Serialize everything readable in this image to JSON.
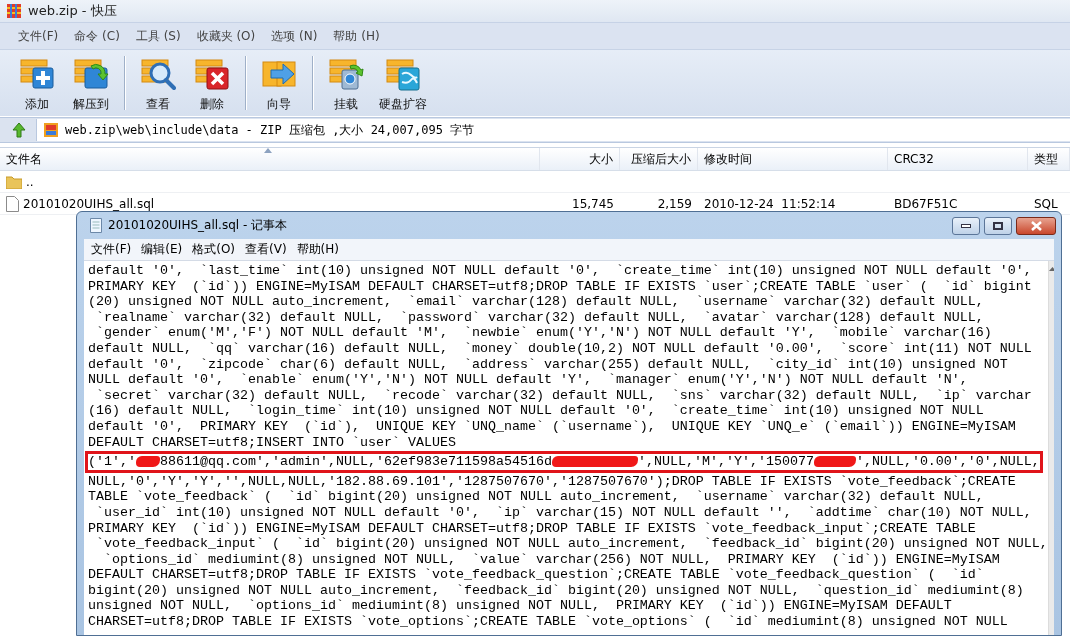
{
  "window": {
    "title": "web.zip - 快压"
  },
  "menu": [
    "文件(F)",
    "命令 (C)",
    "工具 (S)",
    "收藏夹 (O)",
    "选项 (N)",
    "帮助 (H)"
  ],
  "toolbar_groups": [
    [
      {
        "kind": "add",
        "label": "添加"
      },
      {
        "kind": "extract",
        "label": "解压到"
      }
    ],
    [
      {
        "kind": "view",
        "label": "查看"
      },
      {
        "kind": "delete",
        "label": "删除"
      }
    ],
    [
      {
        "kind": "wizard",
        "label": "向导"
      }
    ],
    [
      {
        "kind": "mount",
        "label": "挂载"
      },
      {
        "kind": "disk",
        "label": "硬盘扩容"
      }
    ]
  ],
  "address_bar": {
    "path": "web.zip\\web\\include\\data - ZIP 压缩包 ,大小 24,007,095 字节"
  },
  "file_list": {
    "columns": [
      "文件名",
      "大小",
      "压缩后大小",
      "修改时间",
      "CRC32",
      "类型"
    ],
    "rows": [
      {
        "kind": "folder",
        "cells": [
          ".."
        ]
      },
      {
        "kind": "file",
        "cells": [
          "20101020UIHS_all.sql",
          "15,745",
          "2,159",
          "2010-12-24  11:52:14",
          "BD67F51C",
          "SQL"
        ]
      }
    ]
  },
  "notepad": {
    "title": "20101020UIHS_all.sql - 记事本",
    "menu": [
      "文件(F)",
      "编辑(E)",
      "格式(O)",
      "查看(V)",
      "帮助(H)"
    ],
    "lines": [
      {
        "kind": "plain",
        "text": "default '0',  `last_time` int(10) unsigned NOT NULL default '0',  `create_time` int(10) unsigned NOT NULL default '0',"
      },
      {
        "kind": "plain",
        "text": "PRIMARY KEY  (`id`)) ENGINE=MyISAM DEFAULT CHARSET=utf8;DROP TABLE IF EXISTS `user`;CREATE TABLE `user` (  `id` bigint"
      },
      {
        "kind": "plain",
        "text": "(20) unsigned NOT NULL auto_increment,  `email` varchar(128) default NULL,  `username` varchar(32) default NULL,"
      },
      {
        "kind": "plain",
        "text": " `realname` varchar(32) default NULL,  `password` varchar(32) default NULL,  `avatar` varchar(128) default NULL,"
      },
      {
        "kind": "plain",
        "text": " `gender` enum('M','F') NOT NULL default 'M',  `newbie` enum('Y','N') NOT NULL default 'Y',  `mobile` varchar(16)"
      },
      {
        "kind": "plain",
        "text": "default NULL,  `qq` varchar(16) default NULL,  `money` double(10,2) NOT NULL default '0.00',  `score` int(11) NOT NULL"
      },
      {
        "kind": "plain",
        "text": "default '0',  `zipcode` char(6) default NULL,  `address` varchar(255) default NULL,  `city_id` int(10) unsigned NOT"
      },
      {
        "kind": "plain",
        "text": "NULL default '0',  `enable` enum('Y','N') NOT NULL default 'Y',  `manager` enum('Y','N') NOT NULL default 'N',"
      },
      {
        "kind": "plain",
        "text": " `secret` varchar(32) default NULL,  `recode` varchar(32) default NULL,  `sns` varchar(32) default NULL,  `ip` varchar"
      },
      {
        "kind": "plain",
        "text": "(16) default NULL,  `login_time` int(10) unsigned NOT NULL default '0',  `create_time` int(10) unsigned NOT NULL"
      },
      {
        "kind": "plain",
        "text": "default '0',  PRIMARY KEY  (`id`),  UNIQUE KEY `UNQ_name` (`username`),  UNIQUE KEY `UNQ_e` (`email`)) ENGINE=MyISAM"
      },
      {
        "kind": "plain",
        "text": "DEFAULT CHARSET=utf8;INSERT INTO `user` VALUES"
      },
      {
        "kind": "highlighted",
        "segments": [
          {
            "kind": "text",
            "text": "('1','"
          },
          {
            "kind": "redaction"
          },
          {
            "kind": "text",
            "text": "88611@qq.com','admin',NULL,'62ef983e711598a54516d"
          },
          {
            "kind": "redaction"
          },
          {
            "kind": "text",
            "text": "',NULL,'M','Y','150077"
          },
          {
            "kind": "redaction"
          },
          {
            "kind": "text",
            "text": "',NULL,'0.00','0',NULL,"
          }
        ]
      },
      {
        "kind": "plain",
        "text": "NULL,'0','Y','Y','',NULL,NULL,'182.88.69.101','1287507670','1287507670');DROP TABLE IF EXISTS `vote_feedback`;CREATE"
      },
      {
        "kind": "plain",
        "text": "TABLE `vote_feedback` (  `id` bigint(20) unsigned NOT NULL auto_increment,  `username` varchar(32) default NULL,"
      },
      {
        "kind": "plain",
        "text": " `user_id` int(10) unsigned NOT NULL default '0',  `ip` varchar(15) NOT NULL default '',  `addtime` char(10) NOT NULL,"
      },
      {
        "kind": "plain",
        "text": "PRIMARY KEY  (`id`)) ENGINE=MyISAM DEFAULT CHARSET=utf8;DROP TABLE IF EXISTS `vote_feedback_input`;CREATE TABLE"
      },
      {
        "kind": "plain",
        "text": " `vote_feedback_input` (  `id` bigint(20) unsigned NOT NULL auto_increment,  `feedback_id` bigint(20) unsigned NOT NULL,"
      },
      {
        "kind": "plain",
        "text": "  `options_id` mediumint(8) unsigned NOT NULL,  `value` varchar(256) NOT NULL,  PRIMARY KEY  (`id`)) ENGINE=MyISAM"
      },
      {
        "kind": "plain",
        "text": "DEFAULT CHARSET=utf8;DROP TABLE IF EXISTS `vote_feedback_question`;CREATE TABLE `vote_feedback_question` (  `id`"
      },
      {
        "kind": "plain",
        "text": "bigint(20) unsigned NOT NULL auto_increment,  `feedback_id` bigint(20) unsigned NOT NULL,  `question_id` mediumint(8)"
      },
      {
        "kind": "plain",
        "text": "unsigned NOT NULL,  `options_id` mediumint(8) unsigned NOT NULL,  PRIMARY KEY  (`id`)) ENGINE=MyISAM DEFAULT"
      },
      {
        "kind": "plain",
        "text": "CHARSET=utf8;DROP TABLE IF EXISTS `vote_options`;CREATE TABLE `vote_options` (  `id` mediumint(8) unsigned NOT NULL"
      }
    ]
  }
}
